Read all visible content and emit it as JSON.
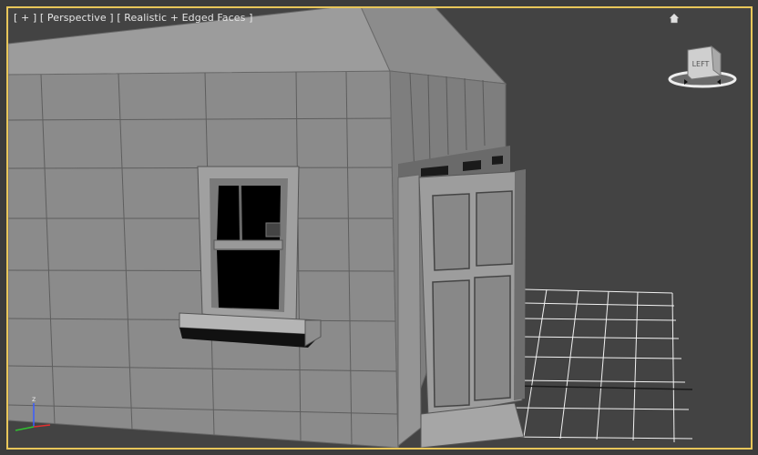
{
  "viewport": {
    "menu_plus": "[ + ]",
    "view_mode": "[ Perspective ]",
    "shading_mode": "[ Realistic + Edged Faces ]"
  },
  "viewcube": {
    "face_label": "LEFT",
    "icon": "viewcube-icon"
  },
  "home_icon": "home-icon",
  "axis": {
    "z_label": "z"
  },
  "colors": {
    "active_border": "#e8c65a",
    "background": "#434343",
    "wall": "#8a8a8a",
    "grid": "#ffffff"
  }
}
